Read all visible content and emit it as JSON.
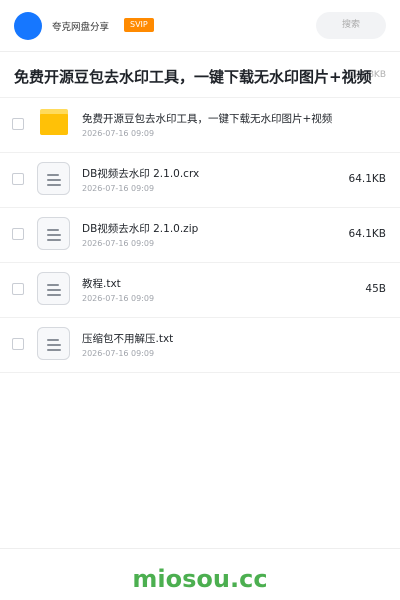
{
  "header": {
    "app_name": "夸克网盘分享",
    "badge": "SVIP",
    "search_placeholder": "搜索"
  },
  "share": {
    "title": "免费开源豆包去水印工具，一键下载无水印图片+视频",
    "size": "128.8KB"
  },
  "files": [
    {
      "type": "folder",
      "icon": "folder-icon",
      "name": "免费开源豆包去水印工具，一键下载无水印图片+视频",
      "date": "2026-07-16 09:09",
      "size": ""
    },
    {
      "type": "file",
      "icon": "file-icon",
      "name": "DB视频去水印 2.1.0.crx",
      "date": "2026-07-16 09:09",
      "size": "64.1KB"
    },
    {
      "type": "file",
      "icon": "file-icon",
      "name": "DB视频去水印 2.1.0.zip",
      "date": "2026-07-16 09:09",
      "size": "64.1KB"
    },
    {
      "type": "file",
      "icon": "file-icon",
      "name": "教程.txt",
      "date": "2026-07-16 09:09",
      "size": "45B"
    },
    {
      "type": "file",
      "icon": "file-icon",
      "name": "压缩包不用解压.txt",
      "date": "2026-07-16 09:09",
      "size": ""
    }
  ],
  "footer": {
    "watermark": "miosou.cc"
  },
  "colors": {
    "avatar": "#1677ff",
    "svip": "#ff8a00",
    "folder": "#ffc107",
    "watermark": "#4caf50"
  }
}
